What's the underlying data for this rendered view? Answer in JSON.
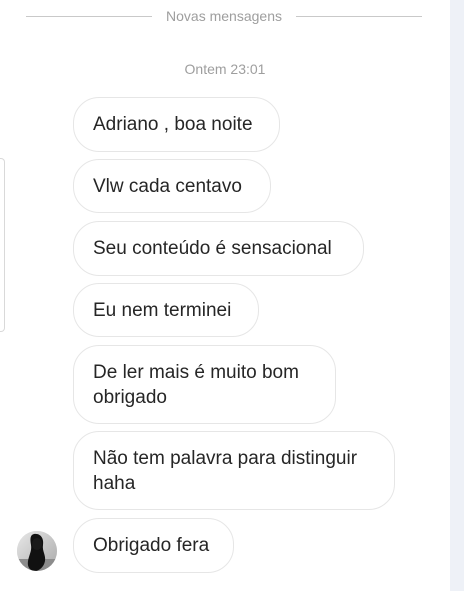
{
  "divider": {
    "label": "Novas mensagens"
  },
  "timestamp": "Ontem 23:01",
  "messages": [
    "Adriano , boa noite",
    "Vlw cada centavo",
    "Seu conteúdo é sensacional",
    "Eu nem terminei",
    "De ler mais é muito bom\nobrigado",
    "Não tem palavra para distinguir\nhaha",
    "Obrigado fera"
  ],
  "avatar": {
    "icon": "user-avatar-photo"
  },
  "colors": {
    "background": "#ffffff",
    "bubble_border": "#e6e6e6",
    "text": "#262626",
    "meta_text": "#9e9e9e",
    "side_strip": "#eef1f7"
  }
}
